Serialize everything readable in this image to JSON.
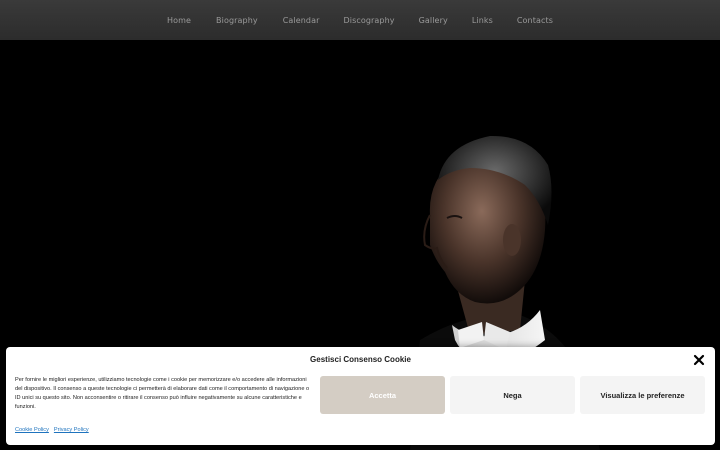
{
  "nav": {
    "items": [
      "Home",
      "Biography",
      "Calendar",
      "Discography",
      "Gallery",
      "Links",
      "Contacts"
    ]
  },
  "hero": {
    "image": "portrait of a conductor in profile on black background"
  },
  "cookie": {
    "title": "Gestisci Consenso Cookie",
    "text": "Per fornire le migliori esperienze, utilizziamo tecnologie come i cookie per memorizzare e/o accedere alle informazioni del dispositivo. Il consenso a queste tecnologie ci permetterà di elaborare dati come il comportamento di navigazione o ID unici su questo sito. Non acconsentire o ritirare il consenso può influire negativamente su alcune caratteristiche e funzioni.",
    "accept_label": "Accetta",
    "deny_label": "Nega",
    "prefs_label": "Visualizza le preferenze",
    "links": [
      "Cookie Policy",
      "Privacy Policy"
    ]
  },
  "colors": {
    "nav_bg": "#333333",
    "accept_bg": "#d4cdc4",
    "link": "#1e73be"
  }
}
